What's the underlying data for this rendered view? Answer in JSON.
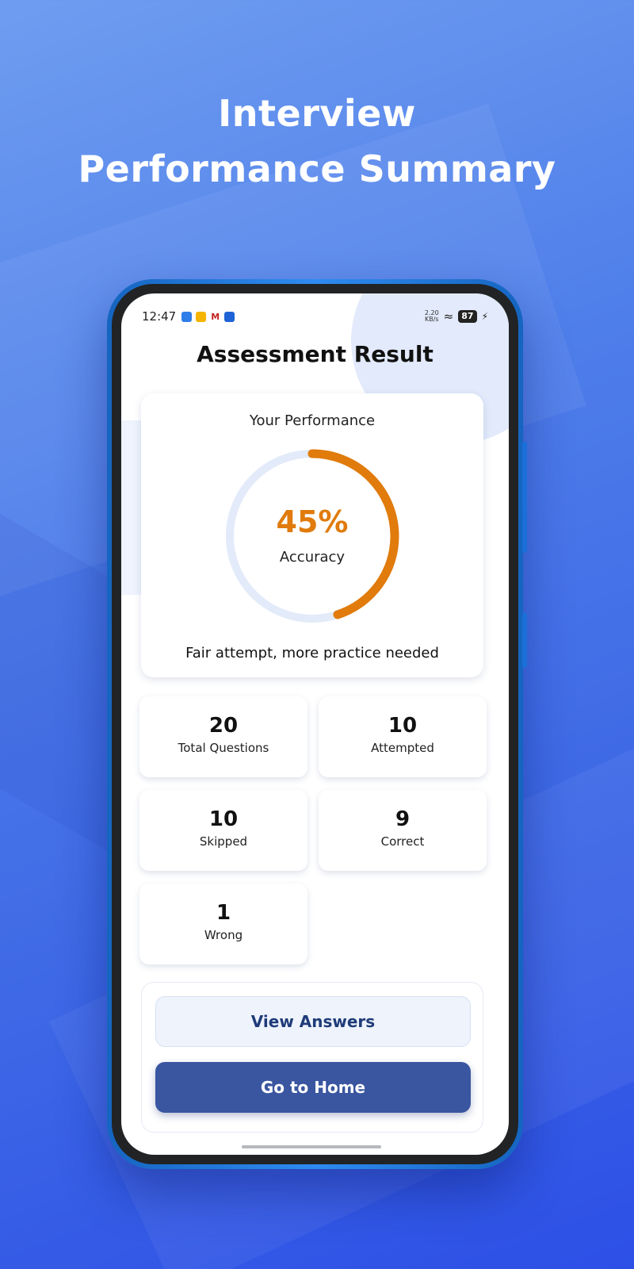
{
  "headline": {
    "line1": "Interview",
    "line2": "Performance Summary"
  },
  "status_bar": {
    "time": "12:47",
    "speed_value": "2.20",
    "speed_unit": "KB/s",
    "battery": "87",
    "icons": [
      "app-notification-icon",
      "mail-notification-icon",
      "gmail-icon",
      "cast-icon",
      "wifi-icon",
      "battery-icon",
      "charging-icon"
    ]
  },
  "screen": {
    "title": "Assessment Result"
  },
  "performance": {
    "label": "Your Performance",
    "accuracy_value": "45%",
    "accuracy_fraction": 0.45,
    "accuracy_label": "Accuracy",
    "message": "Fair attempt, more practice needed"
  },
  "stats": [
    {
      "value": "20",
      "label": "Total Questions"
    },
    {
      "value": "10",
      "label": "Attempted"
    },
    {
      "value": "10",
      "label": "Skipped"
    },
    {
      "value": "9",
      "label": "Correct"
    },
    {
      "value": "1",
      "label": "Wrong"
    }
  ],
  "actions": {
    "view_answers": "View Answers",
    "go_home": "Go to Home"
  },
  "colors": {
    "accent": "#e07b0c",
    "ring_track": "#e3ebfa",
    "primary_button": "#3a56a0",
    "secondary_button": "#eef3fc"
  }
}
